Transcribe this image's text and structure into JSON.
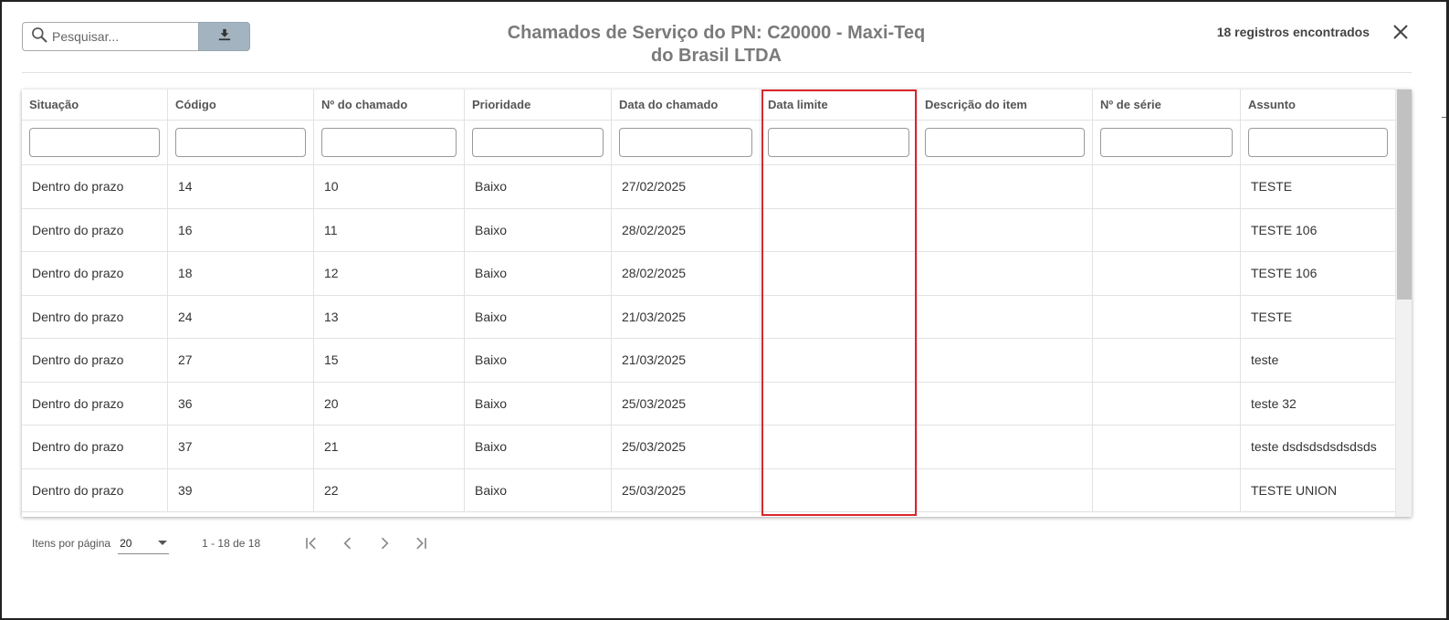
{
  "header": {
    "search_placeholder": "Pesquisar...",
    "title": "Chamados de Serviço do PN: C20000 - Maxi-Teq do Brasil LTDA",
    "record_count": "18 registros encontrados"
  },
  "table": {
    "columns": [
      "Situação",
      "Código",
      "Nº do chamado",
      "Prioridade",
      "Data do chamado",
      "Data limite",
      "Descrição do item",
      "Nº de série",
      "Assunto"
    ],
    "highlighted_column": "Data limite",
    "rows": [
      [
        "Dentro do prazo",
        "14",
        "10",
        "Baixo",
        "27/02/2025",
        "",
        "",
        "",
        "TESTE"
      ],
      [
        "Dentro do prazo",
        "16",
        "11",
        "Baixo",
        "28/02/2025",
        "",
        "",
        "",
        "TESTE 106"
      ],
      [
        "Dentro do prazo",
        "18",
        "12",
        "Baixo",
        "28/02/2025",
        "",
        "",
        "",
        "TESTE 106"
      ],
      [
        "Dentro do prazo",
        "24",
        "13",
        "Baixo",
        "21/03/2025",
        "",
        "",
        "",
        "TESTE"
      ],
      [
        "Dentro do prazo",
        "27",
        "15",
        "Baixo",
        "21/03/2025",
        "",
        "",
        "",
        "teste"
      ],
      [
        "Dentro do prazo",
        "36",
        "20",
        "Baixo",
        "25/03/2025",
        "",
        "",
        "",
        "teste 32"
      ],
      [
        "Dentro do prazo",
        "37",
        "21",
        "Baixo",
        "25/03/2025",
        "",
        "",
        "",
        "teste dsdsdsdsdsdsds"
      ],
      [
        "Dentro do prazo",
        "39",
        "22",
        "Baixo",
        "25/03/2025",
        "",
        "",
        "",
        "TESTE UNION"
      ]
    ]
  },
  "paginator": {
    "items_per_page_label": "Itens por página",
    "items_per_page_value": "20",
    "range_label": "1 - 18 de 18"
  },
  "colors": {
    "highlight_border": "#d9262b",
    "download_button_bg": "#a3b4c0",
    "title_text": "#7a7a7a"
  },
  "icons": [
    "search-icon",
    "download-icon",
    "close-icon",
    "first-page-icon",
    "previous-page-icon",
    "next-page-icon",
    "last-page-icon",
    "chevron-down-icon"
  ]
}
